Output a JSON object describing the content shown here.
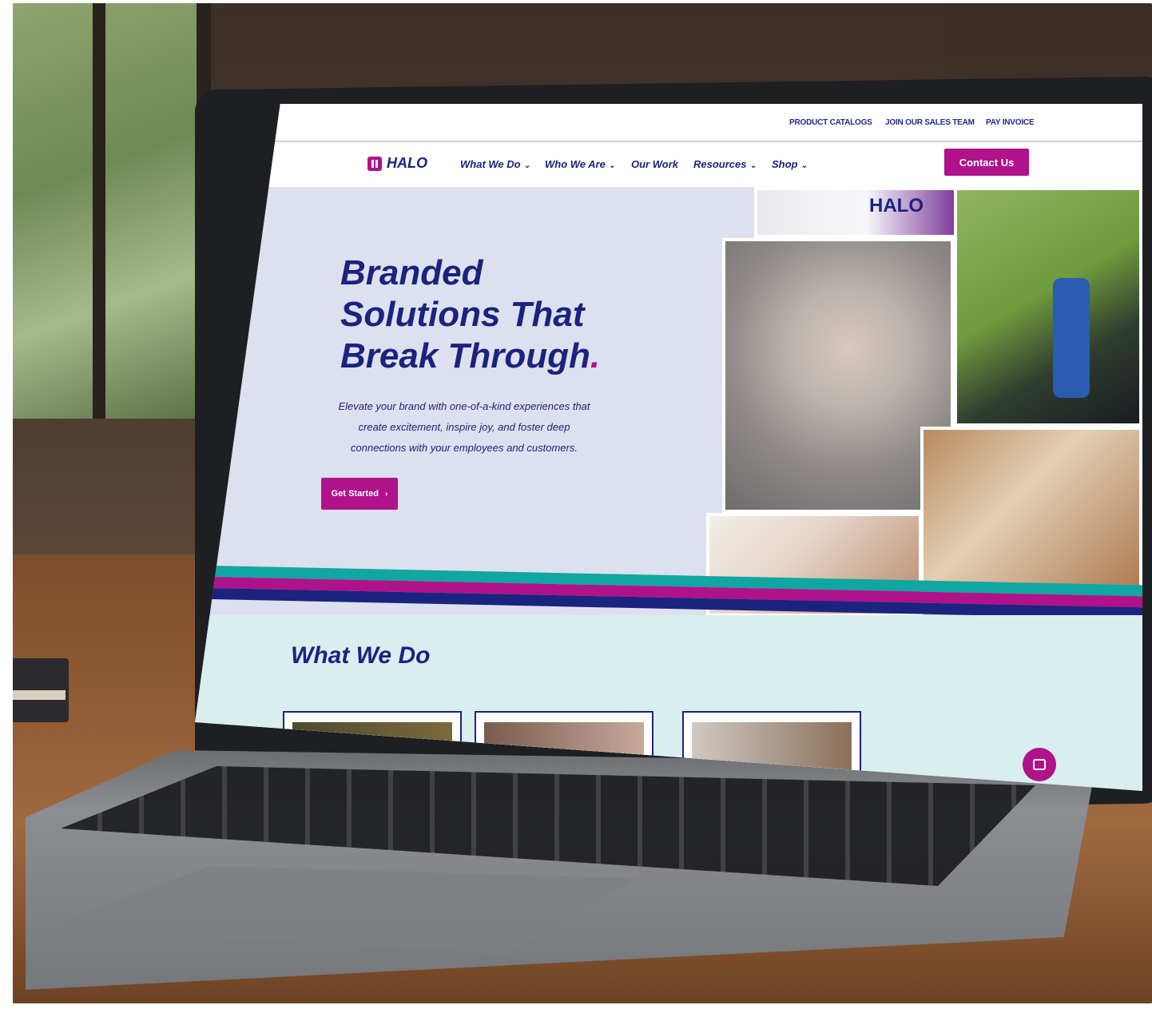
{
  "utility_nav": {
    "links": [
      "PRODUCT CATALOGS",
      "JOIN OUR SALES TEAM",
      "PAY INVOICE"
    ]
  },
  "brand": {
    "logo_text": "HALO",
    "accent": "#b0128a",
    "navy": "#1a237e",
    "teal": "#10a6a1"
  },
  "main_nav": {
    "items": [
      {
        "label": "What We Do",
        "has_dropdown": true
      },
      {
        "label": "Who We Are",
        "has_dropdown": true
      },
      {
        "label": "Our Work",
        "has_dropdown": false
      },
      {
        "label": "Resources",
        "has_dropdown": true
      },
      {
        "label": "Shop",
        "has_dropdown": true
      }
    ],
    "cta": "Contact Us"
  },
  "hero": {
    "title_line1": "Branded",
    "title_line2": "Solutions That",
    "title_line3": "Break Through",
    "title_dot": ".",
    "copy": "Elevate your brand with one-of-a-kind experiences that create excitement, inspire joy, and foster deep connections with your employees and customers.",
    "cta": "Get Started",
    "cta_arrow": "›"
  },
  "collage": {
    "banner_text": "HALO"
  },
  "what_we_do": {
    "title": "What We Do"
  },
  "icons": {
    "chevron": "chevron-down-icon",
    "chat": "chat-icon"
  }
}
